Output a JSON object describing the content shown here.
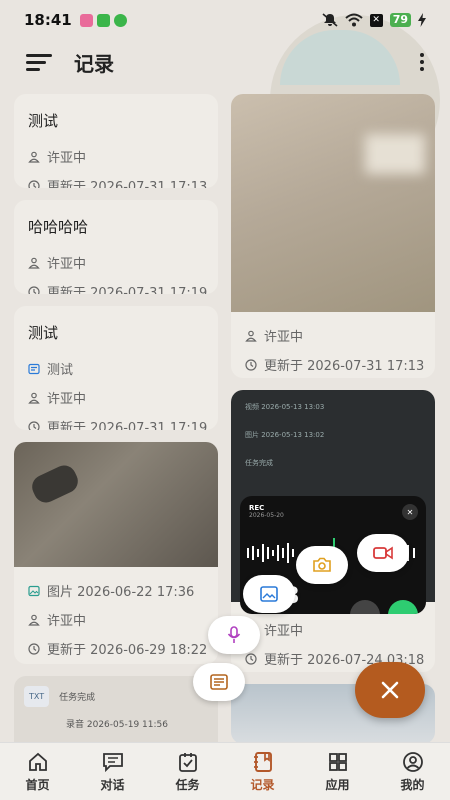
{
  "status": {
    "time": "18:41",
    "battery": "79"
  },
  "header": {
    "title": "记录"
  },
  "left_cards": [
    {
      "title": "测试",
      "author": "许亚中",
      "updated": "更新于 2026-07-31 17:13"
    },
    {
      "title": "哈哈哈哈",
      "author": "许亚中",
      "updated": "更新于 2026-07-31 17:19"
    },
    {
      "title": "测试",
      "tag": "测试",
      "author": "许亚中",
      "updated": "更新于 2026-07-31 17:19"
    },
    {
      "tag": "图片 2026-06-22 17:36",
      "author": "许亚中",
      "updated": "更新于 2026-06-29 18:22"
    }
  ],
  "right_cards": [
    {
      "author": "许亚中",
      "updated": "更新于 2026-07-31 17:13"
    },
    {
      "author": "许亚中",
      "updated": "更新于 2026-07-24 03:18",
      "preview_rows": [
        "视频 2026-05-13 13:03",
        "图片 2026-05-13 13:02",
        "任务完成"
      ]
    }
  ],
  "bottom_card": {
    "rows": [
      "任务完成",
      "录音 2026-05-19 11:56"
    ],
    "badge": "TXT"
  },
  "recorder": {
    "label": "REC",
    "date": "2026-05-20",
    "digit": "8"
  },
  "nav": [
    {
      "label": "首页",
      "icon": "home-icon"
    },
    {
      "label": "对话",
      "icon": "chat-icon"
    },
    {
      "label": "任务",
      "icon": "task-icon"
    },
    {
      "label": "记录",
      "icon": "record-icon",
      "active": true
    },
    {
      "label": "应用",
      "icon": "apps-icon"
    },
    {
      "label": "我的",
      "icon": "profile-icon"
    }
  ],
  "colors": {
    "accent": "#b45b1f",
    "nav_active": "#b3582a",
    "camera": "#e0a020",
    "video": "#d83a3a",
    "image": "#2a7ad8",
    "mic": "#b040c0",
    "note": "#b4651f"
  }
}
